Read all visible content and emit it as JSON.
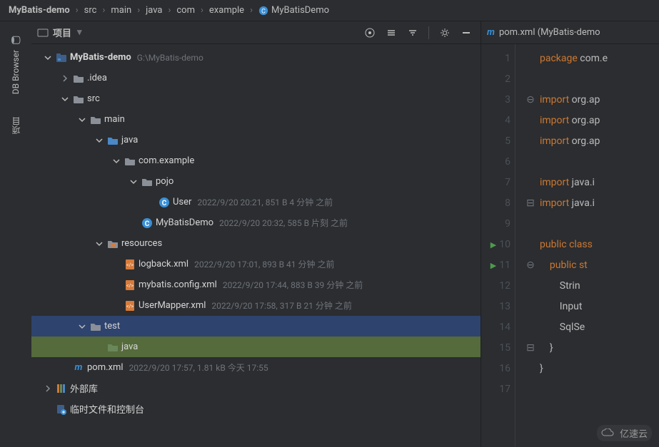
{
  "breadcrumb": [
    {
      "label": "MyBatis-demo",
      "icon": "module"
    },
    {
      "label": "src",
      "icon": null
    },
    {
      "label": "main",
      "icon": null
    },
    {
      "label": "java",
      "icon": null
    },
    {
      "label": "com",
      "icon": null
    },
    {
      "label": "example",
      "icon": null
    },
    {
      "label": "MyBatisDemo",
      "icon": "java"
    }
  ],
  "leftbar": {
    "db_browser": "DB Browser",
    "project": "项目"
  },
  "project_header": {
    "title": "项目"
  },
  "tree": [
    {
      "indent": 0,
      "arrow": "down",
      "icon": "module-blue",
      "label": "MyBatis-demo",
      "bold": true,
      "meta": "G:\\MyBatis-demo"
    },
    {
      "indent": 1,
      "arrow": "right",
      "icon": "folder",
      "label": ".idea"
    },
    {
      "indent": 1,
      "arrow": "down",
      "icon": "folder",
      "label": "src"
    },
    {
      "indent": 2,
      "arrow": "down",
      "icon": "folder",
      "label": "main"
    },
    {
      "indent": 3,
      "arrow": "down",
      "icon": "folder-blue",
      "label": "java"
    },
    {
      "indent": 4,
      "arrow": "down",
      "icon": "folder",
      "label": "com.example"
    },
    {
      "indent": 5,
      "arrow": "down",
      "icon": "folder",
      "label": "pojo"
    },
    {
      "indent": 6,
      "arrow": "",
      "icon": "java",
      "label": "User",
      "meta": "2022/9/20 20:21, 851 B 4 分钟 之前"
    },
    {
      "indent": 5,
      "arrow": "",
      "icon": "java",
      "label": "MyBatisDemo",
      "meta": "2022/9/20 20:32, 585 B 片刻 之前"
    },
    {
      "indent": 3,
      "arrow": "down",
      "icon": "resources",
      "label": "resources"
    },
    {
      "indent": 4,
      "arrow": "",
      "icon": "xml",
      "label": "logback.xml",
      "meta": "2022/9/20 17:01, 893 B 41 分钟 之前"
    },
    {
      "indent": 4,
      "arrow": "",
      "icon": "xml",
      "label": "mybatis.config.xml",
      "meta": "2022/9/20 17:44, 883 B 39 分钟 之前"
    },
    {
      "indent": 4,
      "arrow": "",
      "icon": "xml",
      "label": "UserMapper.xml",
      "meta": "2022/9/20 17:58, 317 B 21 分钟 之前"
    },
    {
      "indent": 2,
      "arrow": "down",
      "icon": "folder",
      "label": "test",
      "selected": true
    },
    {
      "indent": 3,
      "arrow": "",
      "icon": "folder-green",
      "label": "java",
      "highlight": true
    },
    {
      "indent": 1,
      "arrow": "",
      "icon": "maven",
      "label": "pom.xml",
      "meta": "2022/9/20 17:57, 1.81 kB 今天 17:55"
    },
    {
      "indent": 0,
      "arrow": "right",
      "icon": "lib",
      "label": "外部库"
    },
    {
      "indent": 0,
      "arrow": "",
      "icon": "scratch",
      "label": "临时文件和控制台"
    }
  ],
  "editor": {
    "tab": "pom.xml (MyBatis-demo",
    "lines": [
      {
        "n": 1,
        "fold": "",
        "tokens": [
          {
            "t": "package ",
            "c": "kw"
          },
          {
            "t": "com.e",
            "c": ""
          }
        ]
      },
      {
        "n": 2,
        "fold": "",
        "tokens": []
      },
      {
        "n": 3,
        "fold": "⊖",
        "tokens": [
          {
            "t": "import ",
            "c": "kw"
          },
          {
            "t": "org.ap",
            "c": ""
          }
        ]
      },
      {
        "n": 4,
        "fold": "",
        "tokens": [
          {
            "t": "import ",
            "c": "kw"
          },
          {
            "t": "org.ap",
            "c": ""
          }
        ]
      },
      {
        "n": 5,
        "fold": "",
        "tokens": [
          {
            "t": "import ",
            "c": "kw"
          },
          {
            "t": "org.ap",
            "c": ""
          }
        ]
      },
      {
        "n": 6,
        "fold": "",
        "tokens": []
      },
      {
        "n": 7,
        "fold": "",
        "tokens": [
          {
            "t": "import ",
            "c": "kw"
          },
          {
            "t": "java.i",
            "c": ""
          }
        ]
      },
      {
        "n": 8,
        "fold": "⊟",
        "tokens": [
          {
            "t": "import ",
            "c": "kw"
          },
          {
            "t": "java.i",
            "c": ""
          }
        ]
      },
      {
        "n": 9,
        "fold": "",
        "tokens": []
      },
      {
        "n": 10,
        "fold": "",
        "run": true,
        "tokens": [
          {
            "t": "public ",
            "c": "kw"
          },
          {
            "t": "class ",
            "c": "kw"
          }
        ]
      },
      {
        "n": 11,
        "fold": "⊖",
        "run": true,
        "tokens": [
          {
            "t": "    public ",
            "c": "kw"
          },
          {
            "t": "st",
            "c": "kw"
          }
        ]
      },
      {
        "n": 12,
        "fold": "",
        "tokens": [
          {
            "t": "        Strin",
            "c": ""
          }
        ]
      },
      {
        "n": 13,
        "fold": "",
        "tokens": [
          {
            "t": "        Input",
            "c": ""
          }
        ]
      },
      {
        "n": 14,
        "fold": "",
        "tokens": [
          {
            "t": "        SqlSe",
            "c": ""
          }
        ]
      },
      {
        "n": 15,
        "fold": "⊟",
        "tokens": [
          {
            "t": "    }",
            "c": ""
          }
        ]
      },
      {
        "n": 16,
        "fold": "",
        "tokens": [
          {
            "t": "}",
            "c": ""
          }
        ]
      },
      {
        "n": 17,
        "fold": "",
        "tokens": []
      }
    ]
  },
  "watermark": "亿速云"
}
